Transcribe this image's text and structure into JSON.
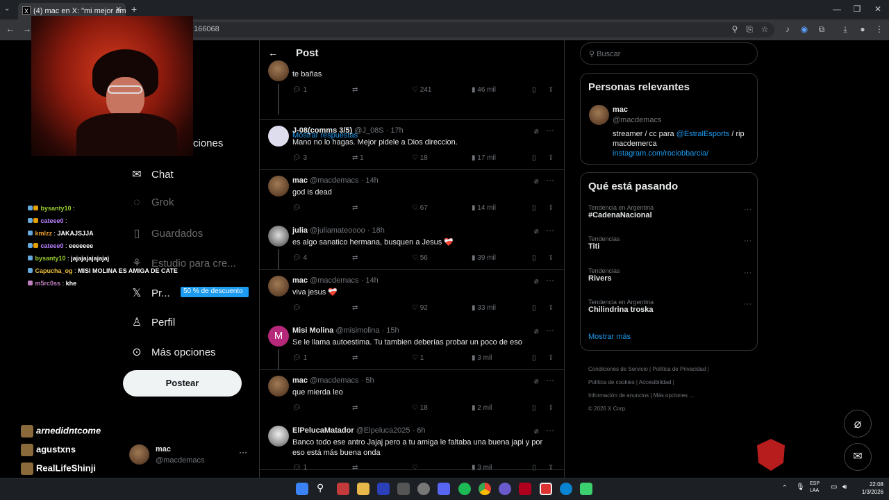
{
  "browser": {
    "tab_title": "(4) mac en X: \"mi mejor amigo",
    "url_fragment": "166068"
  },
  "stream_chat": [
    {
      "user": "bysanty10",
      "message": "",
      "color": "#9acd32"
    },
    {
      "user": "cateee0",
      "message": "",
      "color": "#b983ff"
    },
    {
      "user": "kmlzz",
      "message": "JAKAJSJJA",
      "color": "#f0a030"
    },
    {
      "user": "cateee0",
      "message": "eeeeeee",
      "color": "#b983ff"
    },
    {
      "user": "bysanty10",
      "message": "jajajajajajajaj",
      "color": "#9acd32"
    },
    {
      "user": "Capucha_og",
      "message": "MISI MOLINA ES AMIGA DE CATE",
      "color": "#f0c040"
    },
    {
      "user": "m5rc0ss",
      "message": "khe",
      "color": "#c080c0"
    }
  ],
  "viewers": [
    "arnedidntcome",
    "agustxns",
    "RealLifeShinji"
  ],
  "nav": {
    "notifications_tail": "ciones",
    "chat": "Chat",
    "grok": "Grok",
    "bookmarks": "Guardados",
    "studio": "Estudio para cre...",
    "premium": "Pr...",
    "premium_badge": "50 % de descuento",
    "profile": "Perfil",
    "more": "Más opciones",
    "post_button": "Postear",
    "account_name": "mac",
    "account_handle": "@macdemacs"
  },
  "header": {
    "title": "Post"
  },
  "thread_top": {
    "text": "te bañas",
    "replies": "1",
    "likes": "241",
    "views": "46 mil",
    "show_replies": "Mostrar respuestas"
  },
  "tweets": [
    {
      "name": "J-08(comms 3/5)",
      "handle": "@J_08S · 17h",
      "text": "Mano no lo hagas. Mejor pidele a Dios direccion.",
      "replies": "3",
      "retweets": "1",
      "likes": "18",
      "views": "17 mil"
    },
    {
      "name": "mac",
      "handle": "@macdemacs · 14h",
      "text": "god is dead",
      "replies": "",
      "retweets": "",
      "likes": "67",
      "views": "14 mil"
    },
    {
      "name": "julia",
      "handle": "@juliamateoooo · 18h",
      "text": "es algo sanatico hermana, busquen a Jesus ❤️‍🩹",
      "replies": "4",
      "retweets": "",
      "likes": "56",
      "views": "39 mil"
    },
    {
      "name": "mac",
      "handle": "@macdemacs · 14h",
      "text": "viva jesus ❤️‍🩹",
      "replies": "",
      "retweets": "",
      "likes": "92",
      "views": "33 mil"
    },
    {
      "name": "Misi Molina",
      "handle": "@misimolina · 15h",
      "text": "Se le llama autoestima.  Tu tambien deberías probar un poco de eso",
      "replies": "1",
      "retweets": "",
      "likes": "1",
      "views": "3 mil"
    },
    {
      "name": "mac",
      "handle": "@macdemacs · 5h",
      "text": "que mierda leo",
      "replies": "",
      "retweets": "",
      "likes": "18",
      "views": "2 mil"
    },
    {
      "name": "ElPelucaMatador",
      "handle": "@Elpeluca2025 · 6h",
      "text": "Banco todo ese antro Jajaj pero a tu amiga le faltaba una buena japi y por eso está más buena onda",
      "replies": "1",
      "retweets": "",
      "likes": "",
      "views": "3 mil"
    }
  ],
  "search": {
    "placeholder": "Buscar"
  },
  "relevant": {
    "title": "Personas relevantes",
    "name": "mac",
    "handle": "@macdemacs",
    "bio_pre": "streamer / cc para ",
    "bio_link": "@EstralEsports",
    "bio_post": " / rip",
    "bio_line2": "macdemerca",
    "bio_url": "instagram.com/rociobbarcia/"
  },
  "trends": {
    "title": "Qué está pasando",
    "items": [
      {
        "category": "Tendencia en Argentina",
        "name": "#CadenaNacional"
      },
      {
        "category": "Tendencias",
        "name": "Titi"
      },
      {
        "category": "Tendencias",
        "name": "Rivers"
      },
      {
        "category": "Tendencia en Argentina",
        "name": "Chilindrina troska"
      }
    ],
    "show_more": "Mostrar más"
  },
  "footer": {
    "links": [
      "Condiciones de Servicio",
      "Política de Privacidad",
      "Política de cookies",
      "Accesibilidad",
      "Información de anuncios",
      "Más opciones ..."
    ],
    "copyright": "© 2026 X Corp."
  },
  "taskbar": {
    "lang1": "ESP",
    "lang2": "LAA",
    "time": "22:08",
    "date": "1/3/2026"
  }
}
